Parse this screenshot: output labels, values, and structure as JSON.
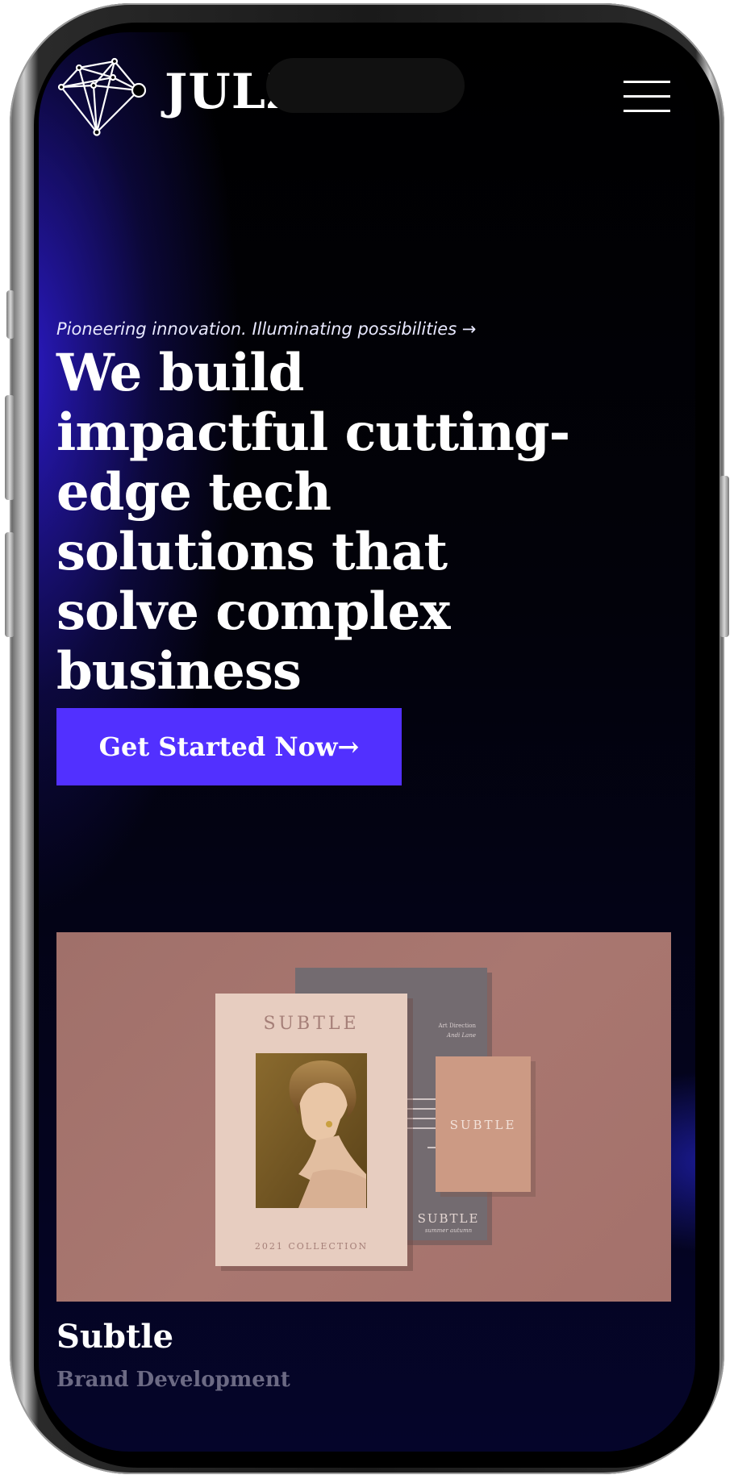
{
  "header": {
    "brand": "JULZ",
    "logo_icon": "network-diamond-icon",
    "menu_icon": "hamburger-menu-icon"
  },
  "hero": {
    "tagline": "Pioneering innovation. Illuminating possibilities →",
    "headline": "We build impactful cutting-edge tech solutions that solve complex business challenges",
    "cta_label": "Get Started Now→"
  },
  "portfolio": {
    "items": [
      {
        "title": "Subtle",
        "category": "Brand Development",
        "image": {
          "cover_brand": "SUBTLE",
          "cover_footer": "2021 COLLECTION",
          "back_brand": "SUBTLE",
          "back_sub": "summer autumn",
          "back_credit_line1": "Art Direction",
          "back_credit_line2": "Andi Lane",
          "small_card_brand": "SUBTLE"
        }
      }
    ]
  },
  "colors": {
    "accent": "#5230FF",
    "background": "#000000",
    "glow": "#2A1FE0",
    "card_bg": "#A97770",
    "muted_text": "#6C6A84"
  }
}
